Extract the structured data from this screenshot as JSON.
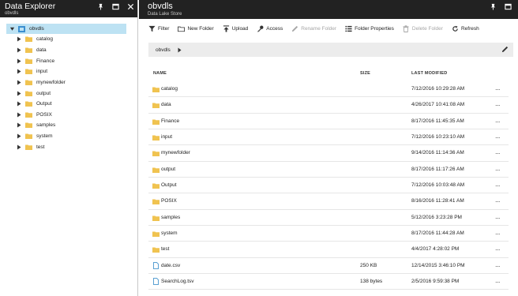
{
  "left_blade": {
    "title": "Data Explorer",
    "subtitle": "obvdls",
    "icons": [
      "pin-icon",
      "maximize-icon",
      "close-icon"
    ],
    "tree": {
      "root": "obvdls",
      "items": [
        "catalog",
        "data",
        "Finance",
        "input",
        "mynewfolder",
        "output",
        "Output",
        "POSIX",
        "samples",
        "system",
        "test"
      ]
    }
  },
  "right_blade": {
    "title": "obvdls",
    "subtitle": "Data Lake Store",
    "icons": [
      "pin-icon",
      "maximize-icon"
    ],
    "toolbar": {
      "filter": "Filter",
      "new_folder": "New Folder",
      "upload": "Upload",
      "access": "Access",
      "rename_folder": "Rename Folder",
      "folder_properties": "Folder Properties",
      "delete_folder": "Delete Folder",
      "refresh": "Refresh"
    },
    "path": {
      "segment": "obvdls"
    },
    "columns": {
      "name": "NAME",
      "size": "SIZE",
      "modified": "LAST MODIFIED"
    },
    "rows": [
      {
        "type": "folder",
        "name": "catalog",
        "size": "",
        "modified": "7/12/2016 10:29:28 AM"
      },
      {
        "type": "folder",
        "name": "data",
        "size": "",
        "modified": "4/26/2017 10:41:08 AM"
      },
      {
        "type": "folder",
        "name": "Finance",
        "size": "",
        "modified": "8/17/2016 11:45:35 AM"
      },
      {
        "type": "folder",
        "name": "input",
        "size": "",
        "modified": "7/12/2016 10:23:10 AM"
      },
      {
        "type": "folder",
        "name": "mynewfolder",
        "size": "",
        "modified": "9/14/2016 11:14:36 AM"
      },
      {
        "type": "folder",
        "name": "output",
        "size": "",
        "modified": "8/17/2016 11:17:26 AM"
      },
      {
        "type": "folder",
        "name": "Output",
        "size": "",
        "modified": "7/12/2016 10:03:48 AM"
      },
      {
        "type": "folder",
        "name": "POSIX",
        "size": "",
        "modified": "8/16/2016 11:28:41 AM"
      },
      {
        "type": "folder",
        "name": "samples",
        "size": "",
        "modified": "5/12/2016 3:23:28 PM"
      },
      {
        "type": "folder",
        "name": "system",
        "size": "",
        "modified": "8/17/2016 11:44:28 AM"
      },
      {
        "type": "folder",
        "name": "test",
        "size": "",
        "modified": "4/4/2017 4:28:02 PM"
      },
      {
        "type": "file",
        "name": "date.csv",
        "size": "250 KB",
        "modified": "12/14/2015 3:46:10 PM"
      },
      {
        "type": "file",
        "name": "SearchLog.tsv",
        "size": "138 bytes",
        "modified": "2/5/2016 9:59:38 PM"
      }
    ],
    "more_label": "..."
  },
  "colors": {
    "header_bg": "#222222",
    "selected_bg": "#bde2f3",
    "folder": "#f0c350",
    "file": "#5aa0d2",
    "pathbar_bg": "#ececec"
  }
}
